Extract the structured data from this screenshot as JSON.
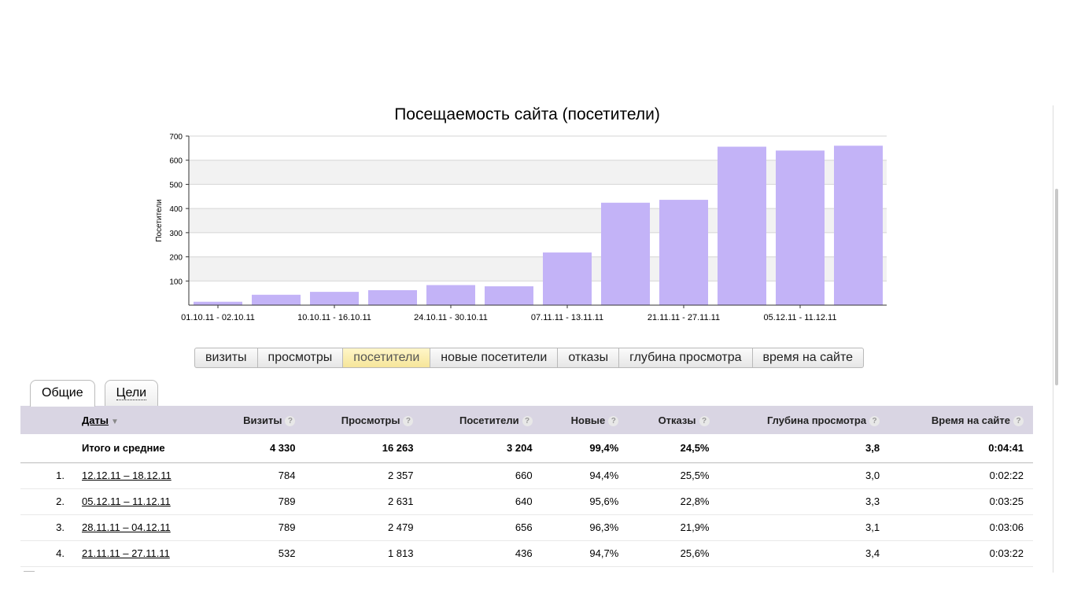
{
  "chart_data": {
    "type": "bar",
    "title": "Посещаемость сайта (посетители)",
    "ylabel": "Посетители",
    "ylim": [
      0,
      700
    ],
    "yticks": [
      100,
      200,
      300,
      400,
      500,
      600,
      700
    ],
    "xtick_labels": [
      "01.10.11 - 02.10.11",
      "10.10.11 - 16.10.11",
      "24.10.11 - 30.10.11",
      "07.11.11 - 13.11.11",
      "21.11.11 - 27.11.11",
      "05.12.11 - 11.12.11"
    ],
    "xtick_bar_index": [
      0,
      2,
      4,
      6,
      8,
      10
    ],
    "values": [
      14,
      43,
      55,
      62,
      83,
      78,
      218,
      424,
      436,
      656,
      640,
      660
    ],
    "bar_color": "#c3b3f7",
    "grid": true
  },
  "metric_switch": {
    "options": [
      "визиты",
      "просмотры",
      "посетители",
      "новые посетители",
      "отказы",
      "глубина просмотра",
      "время на сайте"
    ],
    "selected": "посетители"
  },
  "tabs": [
    {
      "label": "Общие",
      "active": true
    },
    {
      "label": "Цели",
      "active": false
    }
  ],
  "table": {
    "columns": {
      "dates": "Даты",
      "visits": "Визиты",
      "views": "Просмотры",
      "visitors": "Посетители",
      "new": "Новые",
      "bounces": "Отказы",
      "depth": "Глубина просмотра",
      "time": "Время на сайте"
    },
    "help_glyph": "?",
    "sort_glyph": "▼",
    "totals": {
      "label": "Итого и средние",
      "visits": "4 330",
      "views": "16 263",
      "visitors": "3 204",
      "new": "99,4%",
      "bounces": "24,5%",
      "depth": "3,8",
      "time": "0:04:41"
    },
    "rows": [
      {
        "num": "1.",
        "dates": "12.12.11 – 18.12.11",
        "visits": "784",
        "views": "2 357",
        "visitors": "660",
        "new": "94,4%",
        "bounces": "25,5%",
        "depth": "3,0",
        "time": "0:02:22"
      },
      {
        "num": "2.",
        "dates": "05.12.11 – 11.12.11",
        "visits": "789",
        "views": "2 631",
        "visitors": "640",
        "new": "95,6%",
        "bounces": "22,8%",
        "depth": "3,3",
        "time": "0:03:25"
      },
      {
        "num": "3.",
        "dates": "28.11.11 – 04.12.11",
        "visits": "789",
        "views": "2 479",
        "visitors": "656",
        "new": "96,3%",
        "bounces": "21,9%",
        "depth": "3,1",
        "time": "0:03:06"
      },
      {
        "num": "4.",
        "dates": "21.11.11 – 27.11.11",
        "visits": "532",
        "views": "1 813",
        "visitors": "436",
        "new": "94,7%",
        "bounces": "25,6%",
        "depth": "3,4",
        "time": "0:03:22"
      }
    ]
  }
}
